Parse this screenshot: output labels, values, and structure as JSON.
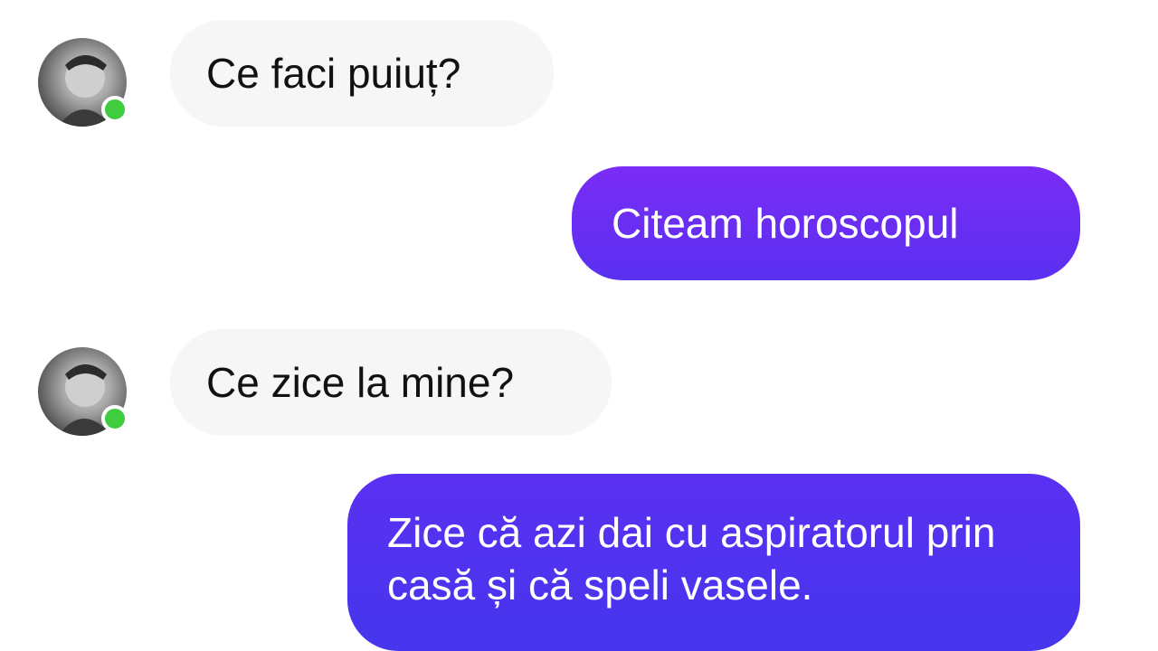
{
  "conversation": {
    "messages": [
      {
        "sender": "contact",
        "text": "Ce faci puiuț?"
      },
      {
        "sender": "me",
        "text": "Citeam horoscopul"
      },
      {
        "sender": "contact",
        "text": "Ce zice la mine?"
      },
      {
        "sender": "me",
        "text": "Zice că azi dai cu aspiratorul prin casă și că speli vasele."
      }
    ]
  },
  "theme": {
    "outgoing_gradient_top": "#7a2cf5",
    "outgoing_gradient_bottom": "#4a35ef",
    "incoming_bg": "#f6f6f6",
    "online_indicator": "#3fcc3f"
  }
}
